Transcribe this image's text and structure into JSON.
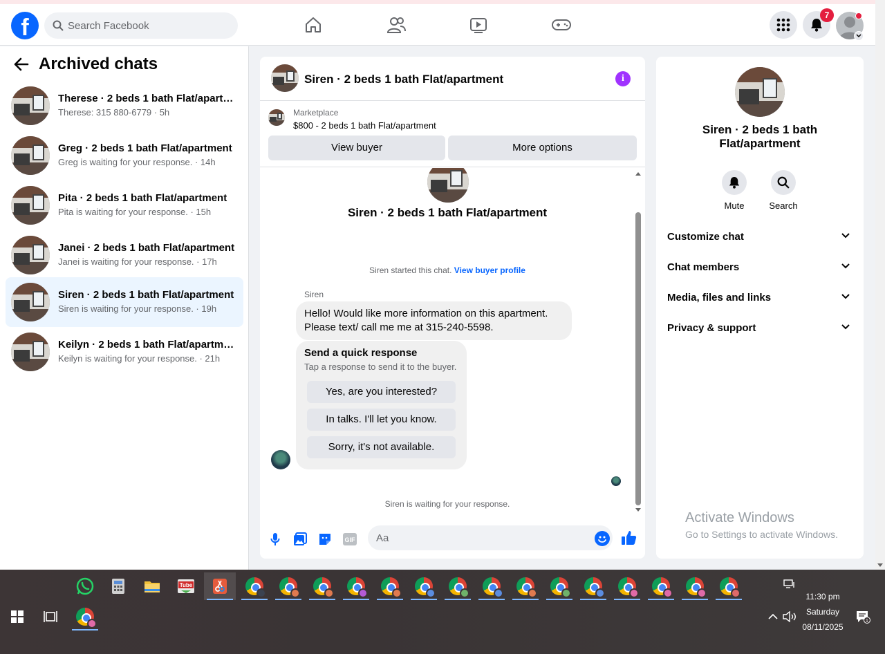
{
  "topbar": {
    "logo_letter": "f",
    "search_placeholder": "Search Facebook",
    "notification_count": "7"
  },
  "left": {
    "title": "Archived chats",
    "chats": [
      {
        "name": "Therese · 2 beds 1 bath Flat/apartment",
        "sub": "Therese: 315 880-6779 · 5h",
        "active": false
      },
      {
        "name": "Greg · 2 beds 1 bath Flat/apartment",
        "sub": "Greg is waiting for your response. · 14h",
        "active": false
      },
      {
        "name": "Pita · 2 beds 1 bath Flat/apartment",
        "sub": "Pita is waiting for your response. · 15h",
        "active": false
      },
      {
        "name": "Janei · 2 beds 1 bath Flat/apartment",
        "sub": "Janei is waiting for your response. · 17h",
        "active": false
      },
      {
        "name": "Siren · 2 beds 1 bath Flat/apartment",
        "sub": "Siren is waiting for your response. · 19h",
        "active": true
      },
      {
        "name": "Keilyn · 2 beds 1 bath Flat/apartment",
        "sub": "Keilyn is waiting for your response. · 21h",
        "active": false
      }
    ]
  },
  "chat": {
    "title": "Siren · 2 beds 1 bath Flat/apartment",
    "marketplace_label": "Marketplace",
    "listing": "$800 - 2 beds 1 bath Flat/apartment",
    "view_buyer": "View buyer",
    "more_options": "More options",
    "convo_name": "Siren · 2 beds 1 bath Flat/apartment",
    "started_text": "Siren started this chat. ",
    "view_profile": "View buyer profile",
    "sender": "Siren",
    "message": "Hello! Would like more information on this apartment. Please text/ call me me at 315-240-5598.",
    "quick_title": "Send a quick response",
    "quick_sub": "Tap a response to send it to the buyer.",
    "quick_responses": [
      "Yes, are you interested?",
      "In talks. I'll let you know.",
      "Sorry, it's not available."
    ],
    "waiting": "Siren is waiting for your response.",
    "input_placeholder": "Aa",
    "gif_label": "GIF"
  },
  "right": {
    "name": "Siren · 2 beds 1 bath Flat/apartment",
    "mute": "Mute",
    "search": "Search",
    "sections": [
      "Customize chat",
      "Chat members",
      "Media, files and links",
      "Privacy & support"
    ]
  },
  "watermark": {
    "line1": "Activate Windows",
    "line2": "Go to Settings to activate Windows."
  },
  "taskbar": {
    "time": "11:30 pm",
    "day": "Saturday",
    "date": "08/11/2025",
    "notif_count": "1",
    "youtube_label": "Tube",
    "chrome_profile_colors": [
      "#e07a4f",
      "#e07a4f",
      "#e07a4f",
      "#b45bd6",
      "#e07a4f",
      "#5b8de0",
      "#6fb26a",
      "#5b8de0",
      "#e07a4f",
      "#6fb26a",
      "#5b8de0",
      "#e06aa8",
      "#e06aa8",
      "#e06aa8",
      "#e06a6a"
    ]
  }
}
